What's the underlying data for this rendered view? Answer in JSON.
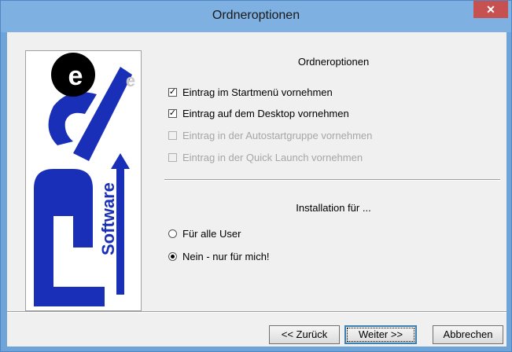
{
  "window": {
    "title": "Ordneroptionen",
    "close_glyph": "✕"
  },
  "options": {
    "heading": "Ordneroptionen",
    "items": [
      {
        "label": "Eintrag im Startmenü vornehmen",
        "checked": true,
        "enabled": true
      },
      {
        "label": "Eintrag auf dem Desktop vornehmen",
        "checked": true,
        "enabled": true
      },
      {
        "label": "Eintrag in der Autostartgruppe vornehmen",
        "checked": false,
        "enabled": false
      },
      {
        "label": "Eintrag in der Quick Launch vornehmen",
        "checked": false,
        "enabled": false
      }
    ]
  },
  "install": {
    "heading": "Installation für ...",
    "radios": [
      {
        "label": "Für alle User",
        "selected": false
      },
      {
        "label": "Nein - nur für mich!",
        "selected": true
      }
    ]
  },
  "buttons": {
    "back": "<< Zurück",
    "next": "Weiter >>",
    "cancel": "Abbrechen"
  },
  "logo": {
    "word": "Software",
    "letter": "e"
  },
  "colors": {
    "titlebar": "#7fb0e2",
    "close": "#c75050",
    "logo_blue": "#1a2fb8"
  }
}
